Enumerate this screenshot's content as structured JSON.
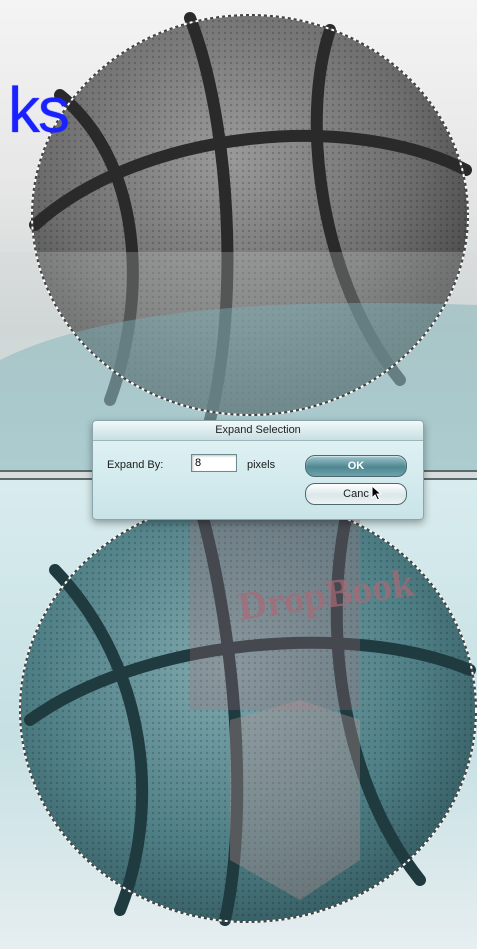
{
  "brand": {
    "wordmark_text": "ks",
    "wordmark_color": "#1a21ff"
  },
  "watermark": {
    "text": "DropBook",
    "color": "#a86a76"
  },
  "dialog": {
    "title": "Expand Selection",
    "expand_label": "Expand By:",
    "expand_value": "8",
    "units": "pixels",
    "ok_label": "OK",
    "cancel_label": "Canc"
  },
  "icons": {
    "cursor": "arrow-cursor-icon",
    "selection": "marching-ants-selection",
    "image": "basketball-image"
  },
  "colors": {
    "overlay_teal": "#5aa3ad",
    "ok_button": "#4f8791",
    "dialog_bg": "#d6ecef"
  }
}
